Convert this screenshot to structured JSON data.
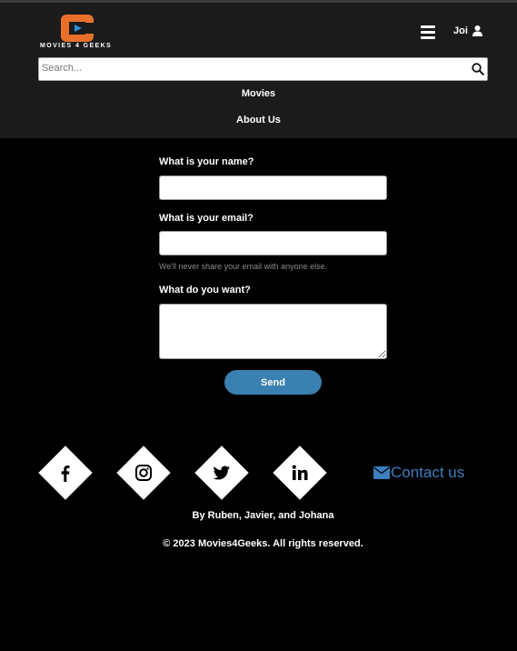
{
  "header": {
    "logo_text": "MOVIES 4 GEEKS",
    "user_name": "Joi",
    "search_placeholder": "Search...",
    "nav": [
      "Movies",
      "About Us"
    ]
  },
  "form": {
    "name_label": "What is your name?",
    "email_label": "What is your email?",
    "email_help": "We'll never share your email with anyone else.",
    "message_label": "What do you want?",
    "name_value": "",
    "email_value": "",
    "message_value": "",
    "send_label": "Send"
  },
  "footer": {
    "social": [
      {
        "icon": "facebook-icon"
      },
      {
        "icon": "instagram-icon"
      },
      {
        "icon": "twitter-icon"
      },
      {
        "icon": "linkedin-icon"
      }
    ],
    "contact_label": "Contact us",
    "contact_icon": "envelope-icon",
    "credits": "By Ruben, Javier, and Johana",
    "copyright": "© 2023 Movies4Geeks. All rights reserved."
  },
  "colors": {
    "background": "#000000",
    "header_background": "#1b1b1b",
    "logo_orange": "#e8702a",
    "button_blue": "#3a80b0",
    "contact_blue": "#3b7fbf"
  }
}
